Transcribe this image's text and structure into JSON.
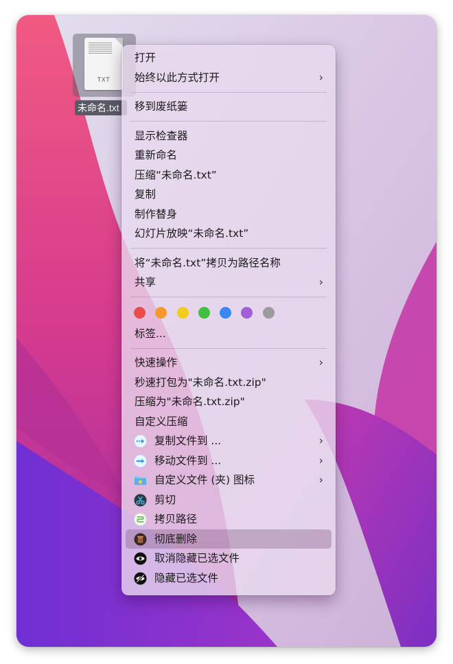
{
  "desktop_file": {
    "type_label": "TXT",
    "name": "未命名.txt"
  },
  "menu": {
    "open": "打开",
    "open_with": "始终以此方式打开",
    "move_to_trash": "移到废纸篓",
    "show_inspector": "显示检查器",
    "rename": "重新命名",
    "compress": "压缩“未命名.txt”",
    "duplicate": "复制",
    "make_alias": "制作替身",
    "slideshow": "幻灯片放映“未命名.txt”",
    "copy_as_pathname": "将“未命名.txt”拷贝为路径名称",
    "share": "共享",
    "tags_label": "标签...",
    "tag_colors": [
      "#ec4b4b",
      "#f39a2a",
      "#f2cc1c",
      "#3fc13f",
      "#3a86f2",
      "#a35fd6",
      "#9b9b9b"
    ],
    "quick_actions": "快速操作",
    "quick_zip": "秒速打包为\"未命名.txt.zip\"",
    "compress_as": "压缩为\"未命名.txt.zip\"",
    "custom_compress": "自定义压缩",
    "copy_file_to": "复制文件到 ...",
    "move_file_to": "移动文件到 ...",
    "custom_folder_icon": "自定义文件 (夹) 图标",
    "cut": "剪切",
    "copy_path": "拷贝路径",
    "delete_permanently": "彻底删除",
    "unhide_selected": "取消隐藏已选文件",
    "hide_selected": "隐藏已选文件"
  }
}
